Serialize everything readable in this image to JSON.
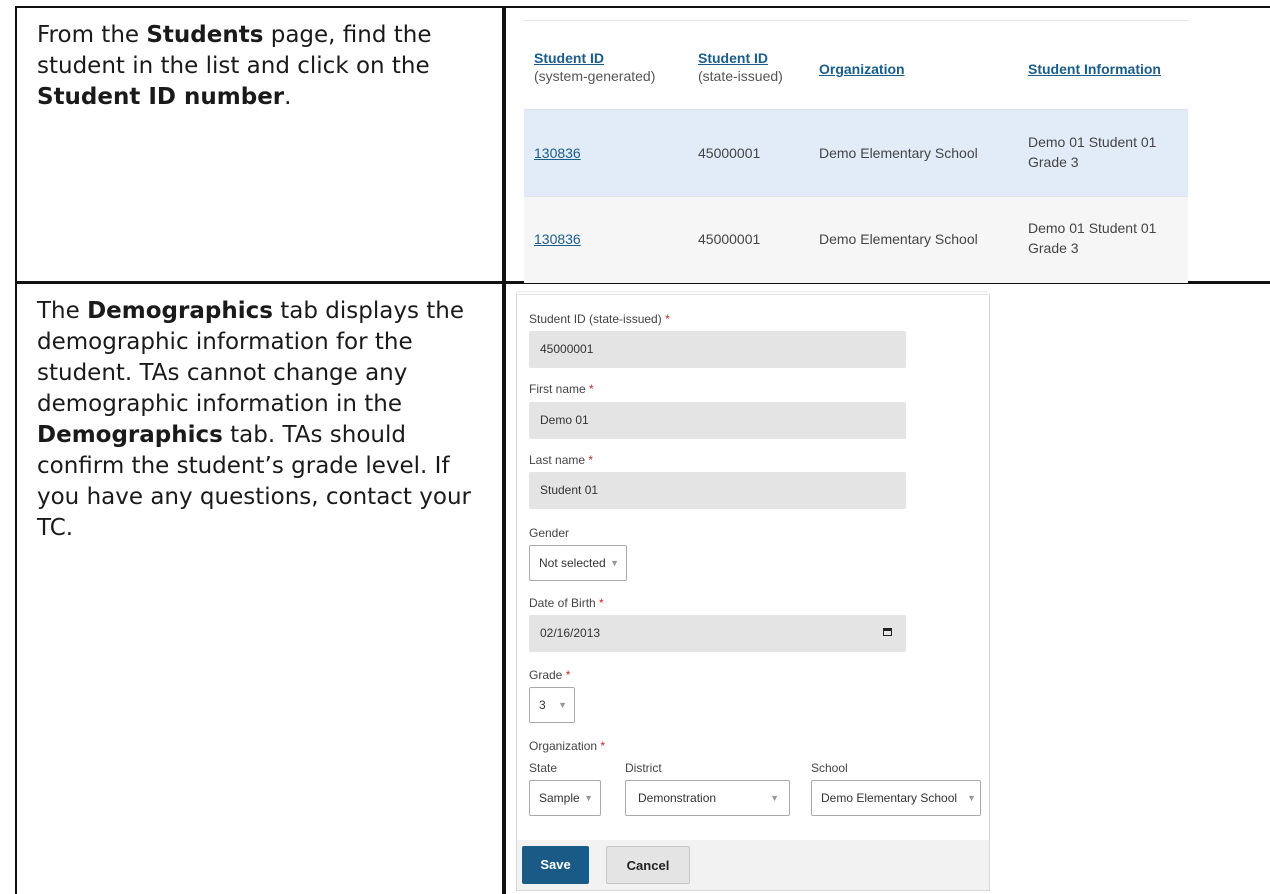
{
  "row1": {
    "instruction": {
      "p1": "From the ",
      "b1": "Students",
      "p2": " page, find the student in the list and click on the ",
      "b2": "Student ID number",
      "p3": "."
    },
    "table": {
      "headers": [
        {
          "title": "Student ID",
          "sub": "(system-generated)"
        },
        {
          "title": "Student ID",
          "sub": "(state-issued)"
        },
        {
          "title": "Organization",
          "sub": ""
        },
        {
          "title": "Student Information",
          "sub": ""
        }
      ],
      "rows": [
        {
          "id": "130836",
          "state_id": "45000001",
          "organization": "Demo Elementary School",
          "info_line1": "Demo 01 Student 01",
          "info_line2": "Grade 3"
        },
        {
          "id": "130836",
          "state_id": "45000001",
          "organization": "Demo Elementary School",
          "info_line1": "Demo 01 Student 01",
          "info_line2": "Grade 3"
        }
      ]
    }
  },
  "row2": {
    "instruction": {
      "p1": "The ",
      "b1": "Demographics",
      "p2": " tab displays the demographic information for the student. TAs cannot change any demographic information in the ",
      "b2": "Demographics",
      "p3": " tab. TAs should confirm the student’s grade level. If you have any questions, contact your TC."
    },
    "form": {
      "state_id_label": "Student ID (state-issued)",
      "state_id_value": "45000001",
      "first_name_label": "First name",
      "first_name_value": "Demo 01",
      "last_name_label": "Last name",
      "last_name_value": "Student 01",
      "gender_label": "Gender",
      "gender_value": "Not selected",
      "dob_label": "Date of Birth",
      "dob_value": "02/16/2013",
      "grade_label": "Grade",
      "grade_value": "3",
      "organization_label": "Organization",
      "state_label": "State",
      "state_value": "Sample",
      "district_label": "District",
      "district_value": "Demonstration",
      "school_label": "School",
      "school_value": "Demo Elementary School",
      "required_mark": "*",
      "save_label": "Save",
      "cancel_label": "Cancel"
    }
  }
}
